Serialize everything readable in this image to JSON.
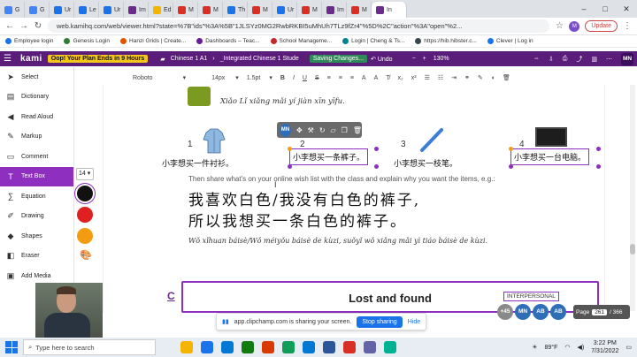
{
  "browser": {
    "tabs": [
      {
        "label": "G",
        "color": "#4285f4"
      },
      {
        "label": "G",
        "color": "#4285f4"
      },
      {
        "label": "Ur",
        "color": "#1a73e8"
      },
      {
        "label": "Le",
        "color": "#1a73e8"
      },
      {
        "label": "Ur",
        "color": "#1a73e8"
      },
      {
        "label": "Im",
        "color": "#6a2b8a"
      },
      {
        "label": "Ed",
        "color": "#f4b400"
      },
      {
        "label": "M",
        "color": "#d93025"
      },
      {
        "label": "M",
        "color": "#d93025"
      },
      {
        "label": "Th",
        "color": "#1a73e8"
      },
      {
        "label": "M",
        "color": "#d93025"
      },
      {
        "label": "Ur",
        "color": "#1a73e8"
      },
      {
        "label": "M",
        "color": "#d93025"
      },
      {
        "label": "Im",
        "color": "#6a2b8a"
      },
      {
        "label": "M",
        "color": "#d93025"
      },
      {
        "label": "In",
        "color": "#6a2b8a"
      }
    ],
    "url": "web.kamihq.com/web/viewer.html?state=%7B\"ids\"%3A%5B\"1JLSYz0MG2RwbRKBI5uMhUh7TLz9fZr4\"%5D%2C\"action\"%3A\"open\"%2...",
    "profile": "M",
    "update_label": "Update"
  },
  "bookmarks": [
    {
      "label": "Employee login",
      "color": "#1a73e8"
    },
    {
      "label": "Genesis Login",
      "color": "#2e7d32"
    },
    {
      "label": "Hanzi Grids | Create...",
      "color": "#e65100"
    },
    {
      "label": "Dashboards – Teac...",
      "color": "#6a1b9a"
    },
    {
      "label": "School Manageme...",
      "color": "#c62828"
    },
    {
      "label": "Login | Cheng & Ts...",
      "color": "#00838f"
    },
    {
      "label": "https://hib.hibster.c...",
      "color": "#37474f"
    },
    {
      "label": "Clever | Log in",
      "color": "#1a73e8"
    }
  ],
  "kami": {
    "logo": "kami",
    "promo": "Oop! Your Plan Ends in 9 Hours",
    "class_name": "Chinese 1 A1",
    "doc_name": "_Integrated Chinese 1 Stude",
    "saving": "Saving Changes...",
    "undo": "Undo",
    "zoom": "130%",
    "user_initials": "MN"
  },
  "format": {
    "font": "Roboto",
    "size": "14px",
    "line_height": "1.5pt"
  },
  "sidebar": [
    {
      "label": "Select",
      "icon": "cursor-icon",
      "glyph": "➤"
    },
    {
      "label": "Dictionary",
      "icon": "book-icon",
      "glyph": "▤"
    },
    {
      "label": "Read Aloud",
      "icon": "speaker-icon",
      "glyph": "◀"
    },
    {
      "label": "Markup",
      "icon": "highlighter-icon",
      "glyph": "✎"
    },
    {
      "label": "Comment",
      "icon": "comment-icon",
      "glyph": "▭"
    },
    {
      "label": "Text Box",
      "icon": "textbox-icon",
      "glyph": "T"
    },
    {
      "label": "Equation",
      "icon": "equation-icon",
      "glyph": "∑"
    },
    {
      "label": "Drawing",
      "icon": "pen-icon",
      "glyph": "✐"
    },
    {
      "label": "Shapes",
      "icon": "shapes-icon",
      "glyph": "◆"
    },
    {
      "label": "Eraser",
      "icon": "eraser-icon",
      "glyph": "◧"
    },
    {
      "label": "Add Media",
      "icon": "media-icon",
      "glyph": "▣"
    }
  ],
  "sidebar_active": "Text Box",
  "options": {
    "text_size": "14",
    "colors": [
      "#111111",
      "#e02020",
      "#f39c12"
    ]
  },
  "document": {
    "pinyin_top": "Xiǎo Lǐ xiǎng mǎi yí jiàn xīn yīfu.",
    "items": [
      {
        "num": "1",
        "caption": "小李想买一件衬衫。"
      },
      {
        "num": "2",
        "caption": "小李想买一条裤子。"
      },
      {
        "num": "3",
        "caption": "小李想买一枝笔。"
      },
      {
        "num": "4",
        "caption": "小李想买一台电脑。"
      }
    ],
    "instruction": "Then share what's on your online wish list with the class and explain why you want the items, e.g.:",
    "hanzi_line1": "我喜欢白色/我没有白色的裤子,",
    "hanzi_line2": "所以我想买一条白色的裤子。",
    "pinyin_example": "Wǒ xǐhuan báisè/Wǒ méiyǒu báisè de kùzi, suǒyǐ wǒ xiǎng mǎi yì tiáo báisè de kùzi.",
    "section_letter": "C",
    "section_title": "Lost and found",
    "section_tag": "INTERPERSONAL",
    "float_initials": "MN"
  },
  "collaborators": {
    "more": "+45",
    "list": [
      {
        "initials": "MN",
        "color": "#2f6fb8"
      },
      {
        "initials": "AB",
        "color": "#2f6fb8"
      },
      {
        "initials": "AB",
        "color": "#2f6fb8"
      }
    ]
  },
  "pagination": {
    "label": "Page",
    "current": "261",
    "total": "/ 366"
  },
  "share_bar": {
    "message": "app.clipchamp.com is sharing your screen.",
    "stop": "Stop sharing",
    "hide": "Hide"
  },
  "taskbar": {
    "search_placeholder": "Type here to search",
    "apps": [
      "#f4b400",
      "#1a73e8",
      "#0078d4",
      "#107c10",
      "#d83b01",
      "#0f9d58",
      "#0078d4",
      "#2b579a",
      "#d93025",
      "#6264a7",
      "#00b294"
    ],
    "weather": "89°F",
    "time": "3:22 PM",
    "date": "7/31/2022"
  }
}
